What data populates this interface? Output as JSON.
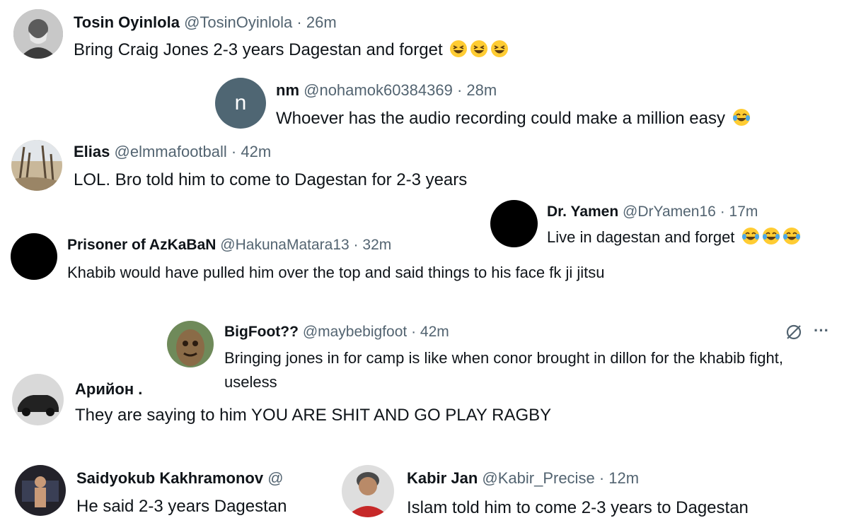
{
  "colors": {
    "text": "#0f1419",
    "secondary": "#536471",
    "letter_avatar": "#4f6673",
    "emoji_face": "#ffcc33"
  },
  "posts": [
    {
      "name": "Tosin Oyinlola",
      "handle": "@TosinOyinlola",
      "sep": "·",
      "time": "26m",
      "text": "Bring Craig Jones 2-3 years Dagestan and forget",
      "emoji": "grinning-squinting-face"
    },
    {
      "name": "nm",
      "handle": "@nohamok60384369",
      "sep": "·",
      "time": "28m",
      "avatar_letter": "n",
      "text": "Whoever has the audio recording could make a million easy",
      "emoji": "face-with-tears-of-joy"
    },
    {
      "name": "Elias",
      "handle": "@elmmafootball",
      "sep": "·",
      "time": "42m",
      "text": "LOL. Bro told him to come to Dagestan for 2-3 years"
    },
    {
      "name": "Dr. Yamen",
      "handle": "@DrYamen16",
      "sep": "·",
      "time": "17m",
      "text": "Live in dagestan and forget",
      "emoji": "face-with-tears-of-joy"
    },
    {
      "name": "Prisoner of AzKaBaN",
      "handle": "@HakunaMatara13",
      "sep": "·",
      "time": "32m",
      "text": "Khabib would have pulled him over the top and said things to his face fk ji jitsu"
    },
    {
      "name": "BigFoot??",
      "handle": "@maybebigfoot",
      "sep": "·",
      "time": "42m",
      "text": "Bringing jones in for camp is like when conor brought in dillon for the khabib fight, useless",
      "actions": {
        "grok_icon": "slashed-circle-icon",
        "more_label": "···"
      }
    },
    {
      "name": "Арийон .",
      "handle": "",
      "sep": "",
      "time": "",
      "text": "They are saying to him YOU ARE SHIT AND GO PLAY RAGBY"
    },
    {
      "name": "Saidyokub Kakhramonov",
      "handle": "@",
      "sep": "",
      "time": "",
      "text": "He said 2-3 years Dagestan"
    },
    {
      "name": "Kabir Jan",
      "handle": "@Kabir_Precise",
      "sep": "·",
      "time": "12m",
      "text": "Islam told him to come 2-3 years to Dagestan"
    }
  ]
}
